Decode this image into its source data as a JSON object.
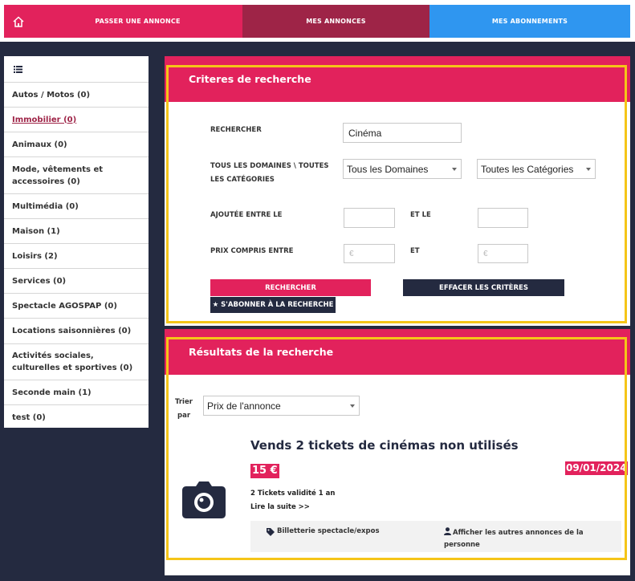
{
  "nav": {
    "post_ad": "PASSER UNE ANNONCE",
    "my_ads": "MES ANNONCES",
    "my_subs": "MES ABONNEMENTS",
    "colors": {
      "pink": "#e2225c",
      "wine": "#9e2447",
      "blue": "#2f96f0",
      "dark": "#242a40"
    }
  },
  "sidebar": {
    "items": [
      {
        "label": "Autos / Motos (0)"
      },
      {
        "label": "Immobilier (0)"
      },
      {
        "label": "Animaux (0)"
      },
      {
        "label": "Mode, vêtements et accessoires (0)"
      },
      {
        "label": "Multimédia (0)"
      },
      {
        "label": "Maison (1)"
      },
      {
        "label": "Loisirs (2)"
      },
      {
        "label": "Services (0)"
      },
      {
        "label": "Spectacle AGOSPAP (0)"
      },
      {
        "label": "Locations saisonnières (0)"
      },
      {
        "label": "Activités sociales, culturelles et sportives (0)"
      },
      {
        "label": "Seconde main (1)"
      },
      {
        "label": "test (0)"
      }
    ]
  },
  "criteria": {
    "title": "Criteres de recherche",
    "search_label": "RECHERCHER",
    "search_value": "Cinéma",
    "domains_label": "TOUS LES DOMAINES \\ TOUTES LES CATÉGORIES",
    "domain_selected": "Tous les Domaines",
    "category_selected": "Toutes les Catégories",
    "added_between_label": "AJOUTÉE ENTRE LE",
    "and_le_label": "ET LE",
    "price_between_label": "PRIX COMPRIS ENTRE",
    "and_label": "ET",
    "price_placeholder": "€",
    "search_button": "RECHERCHER",
    "clear_button": "EFFACER LES CRITÈRES",
    "subscribe_button": "★ S'ABONNER À LA RECHERCHE"
  },
  "results": {
    "title": "Résultats de la recherche",
    "sort_label_1": "Trier",
    "sort_label_2": "par",
    "sort_selected": "Prix de l'annonce",
    "item": {
      "title": "Vends 2 tickets de cinémas non utilisés",
      "price": "15 €",
      "date": "09/01/2024",
      "description": "2 Tickets validité 1 an",
      "read_more": "Lire la suite >>",
      "category": "Billetterie spectacle/expos",
      "other_ads": "Afficher les autres annonces de la personne"
    }
  }
}
